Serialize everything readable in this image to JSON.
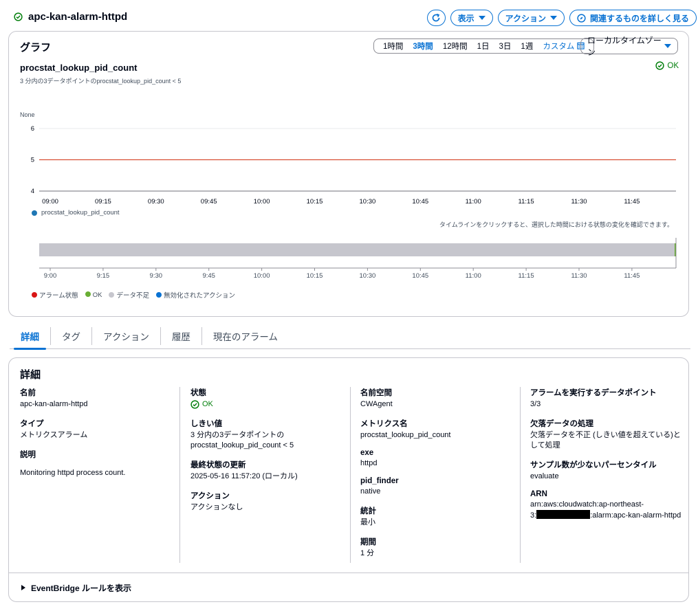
{
  "header": {
    "title": "apc-kan-alarm-httpd",
    "buttons": {
      "view": "表示",
      "actions": "アクション",
      "related": "関連するものを詳しく見る"
    }
  },
  "graph": {
    "title": "グラフ",
    "time_ranges": [
      "1時間",
      "3時間",
      "12時間",
      "1日",
      "3日",
      "1週"
    ],
    "active_range": "3時間",
    "custom_label": "カスタム",
    "timezone": "ローカルタイムゾーン",
    "metric_title": "procstat_lookup_pid_count",
    "metric_subtitle": "3 分内の3データポイントのprocstat_lookup_pid_count < 5",
    "state": "OK",
    "timeline_hint": "タイムラインをクリックすると、選択した時間における状態の変化を確認できます。",
    "legend_alarm": [
      "アラーム状態",
      "OK",
      "データ不足",
      "無効化されたアクション"
    ]
  },
  "chart_data": {
    "type": "line",
    "ylabel": "None",
    "ylim": [
      4,
      6
    ],
    "yticks": [
      "6",
      "5",
      "4"
    ],
    "threshold": 5,
    "x_ticks": [
      "09:00",
      "09:15",
      "09:30",
      "09:45",
      "10:00",
      "10:15",
      "10:30",
      "10:45",
      "11:00",
      "11:15",
      "11:30",
      "11:45"
    ],
    "timeline_ticks": [
      "9:00",
      "9:15",
      "9:30",
      "9:45",
      "10:00",
      "10:15",
      "10:30",
      "10:45",
      "11:00",
      "11:15",
      "11:30",
      "11:45"
    ],
    "series": [
      {
        "name": "procstat_lookup_pid_count",
        "values": []
      }
    ],
    "colors": {
      "series": "#1f77b4",
      "threshold": "#d13212",
      "alarm": "#d91515",
      "ok": "#69ae34",
      "insufficient": "#c6c6cd",
      "disabled": "#0972d3"
    }
  },
  "tabs": [
    "詳細",
    "タグ",
    "アクション",
    "履歴",
    "現在のアラーム"
  ],
  "details": {
    "title": "詳細",
    "col1": {
      "name_label": "名前",
      "name_value": "apc-kan-alarm-httpd",
      "type_label": "タイプ",
      "type_value": "メトリクスアラーム",
      "desc_label": "説明",
      "desc_value": "Monitoring httpd process count."
    },
    "col2": {
      "state_label": "状態",
      "state_value": "OK",
      "threshold_label": "しきい値",
      "threshold_value_1": "3 分内の3データポイントの",
      "threshold_value_2": "procstat_lookup_pid_count < 5",
      "updated_label": "最終状態の更新",
      "updated_value": "2025-05-16 11:57:20 (ローカル)",
      "action_label": "アクション",
      "action_value": "アクションなし"
    },
    "col3": {
      "ns_label": "名前空間",
      "ns_value": "CWAgent",
      "metric_label": "メトリクス名",
      "metric_value": "procstat_lookup_pid_count",
      "exe_label": "exe",
      "exe_value": "httpd",
      "pid_label": "pid_finder",
      "pid_value": "native",
      "stat_label": "統計",
      "stat_value": "最小",
      "period_label": "期間",
      "period_value": "1 分"
    },
    "col4": {
      "dp_label": "アラームを実行するデータポイント",
      "dp_value": "3/3",
      "missing_label": "欠落データの処理",
      "missing_value_1": "欠落データを不正 (しきい値を超えている)と",
      "missing_value_2": "して処理",
      "pct_label": "サンプル数が少ないパーセンタイル",
      "pct_value": "evaluate",
      "arn_label": "ARN",
      "arn_value_1": "arn:aws:cloudwatch:ap-northeast-",
      "arn_prefix": "3:",
      "arn_suffix": ":alarm:apc-kan-alarm-httpd"
    },
    "eventbridge": "EventBridge ルールを表示"
  }
}
